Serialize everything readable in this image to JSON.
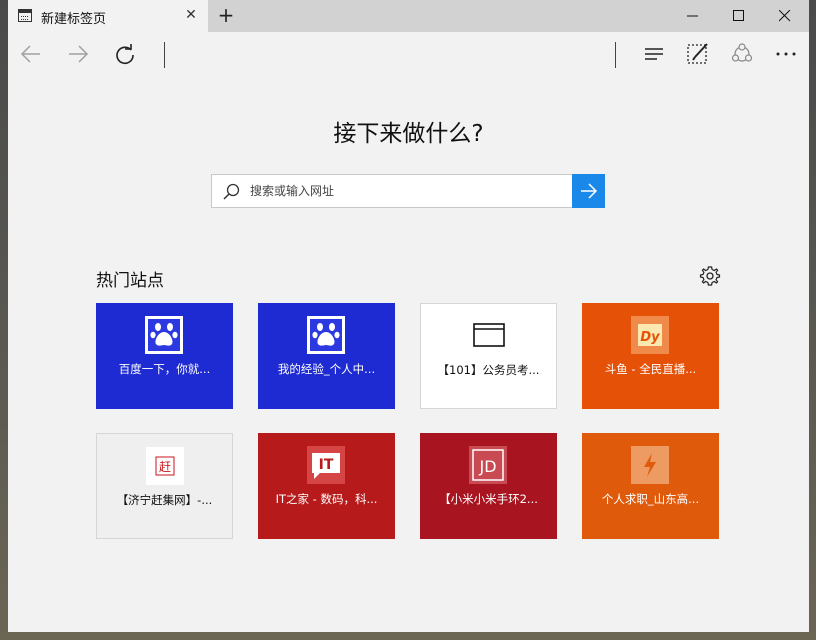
{
  "tab": {
    "title": "新建标签页",
    "close": "✕"
  },
  "new_tab": "+",
  "icons": {
    "back": "back-arrow-icon",
    "forward": "forward-arrow-icon",
    "refresh": "refresh-icon",
    "hub": "hub-icon",
    "note": "web-note-icon",
    "share": "share-icon",
    "more": "more-icon",
    "settings": "gear-icon",
    "search": "search-icon",
    "go": "arrow-right-icon"
  },
  "page": {
    "headline": "接下来做什么?",
    "search_placeholder": "搜索或输入网址",
    "section_title": "热门站点"
  },
  "colors": {
    "accent": "#1a88e8",
    "baidu_blue": "#1e2ad2",
    "douyu_orange": "#e55207",
    "ithome_red": "#b71a1a",
    "xiaomi_red": "#a8141f",
    "job_orange": "#e05a0c"
  },
  "top_sites": [
    {
      "label": "百度一下，你就...",
      "bg": "#1e2ad2",
      "icon": "baidu-paw-icon"
    },
    {
      "label": "我的经验_个人中...",
      "bg": "#1e2ad2",
      "icon": "baidu-paw-icon"
    },
    {
      "label": "【101】公务员考...",
      "bg": "#ffffff",
      "icon": "browser-window-icon"
    },
    {
      "label": "斗鱼 - 全民直播...",
      "bg": "#e55207",
      "icon": "douyu-logo-icon"
    },
    {
      "label": "【济宁赶集网】-...",
      "bg": "#efefef",
      "icon": "ganji-logo-icon"
    },
    {
      "label": "IT之家 - 数码，科...",
      "bg": "#b71a1a",
      "icon": "ithome-logo-icon"
    },
    {
      "label": "【小米小米手环2...",
      "bg": "#a8141f",
      "icon": "jd-logo-icon"
    },
    {
      "label": "个人求职_山东高...",
      "bg": "#e05a0c",
      "icon": "lightning-icon"
    }
  ],
  "tile_icon_text": {
    "douyu": "Dy",
    "ganji": "赶",
    "ithome": "IT",
    "jd": "JD"
  }
}
